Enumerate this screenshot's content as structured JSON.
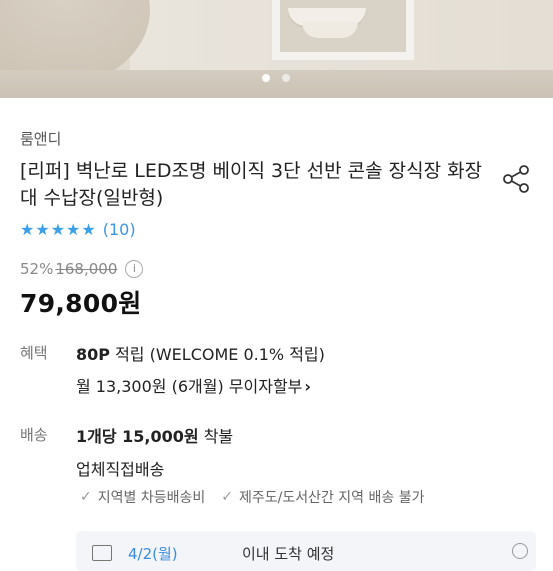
{
  "carousel": {
    "page_dots": 2,
    "active_index": 0
  },
  "brand": "룸앤디",
  "title": "[리퍼] 벽난로 LED조명 베이직 3단 선반 콘솔 장식장 화장대 수납장(일반형)",
  "rating": {
    "stars": 5,
    "count_text": "(10)"
  },
  "price": {
    "discount": "52%",
    "original": "168,000",
    "current": "79,800원"
  },
  "benefit": {
    "label": "혜택",
    "points": "80P",
    "points_text": " 적립 (WELCOME 0.1% 적립)",
    "installment": "월 13,300원 (6개월) 무이자할부",
    "installment_chevron": "›"
  },
  "shipping": {
    "label": "배송",
    "fee": "1개당 15,000원",
    "fee_suffix": " 착불",
    "method": "업체직접배송",
    "notes": [
      "지역별 차등배송비",
      "제주도/도서산간 지역 배송 불가"
    ]
  },
  "delivery_card": {
    "date": "4/2(월)",
    "text": "이내 도착 예정"
  },
  "colors": {
    "accent": "#3a96e0",
    "star": "#3aa0e8"
  },
  "icons": {
    "share": "share-icon",
    "info": "info-icon",
    "check": "check-icon"
  }
}
